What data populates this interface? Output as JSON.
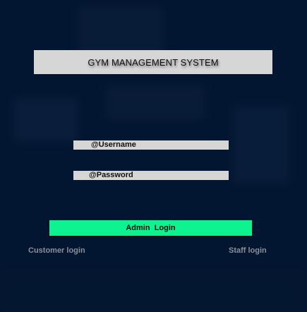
{
  "app": {
    "title": "GYM MANAGEMENT SYSTEM"
  },
  "form": {
    "username_value": "@Username",
    "password_value": "@Password",
    "login_button_label": "Admin  Login"
  },
  "links": {
    "customer_login": "Customer login",
    "staff_login": "Staff login"
  },
  "colors": {
    "background": "#031631",
    "panel": "#d6d6d6",
    "accent": "#0cf38f",
    "link": "#8a8f98"
  }
}
